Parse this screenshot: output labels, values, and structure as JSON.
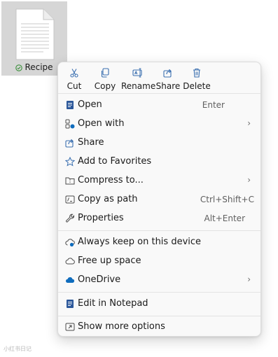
{
  "file": {
    "name": "Recipe",
    "icon": "text-document-icon",
    "status_icon": "sync-check-icon",
    "status_color": "#3a8f3a"
  },
  "quick_actions": [
    {
      "label": "Cut",
      "icon": "scissors-icon"
    },
    {
      "label": "Copy",
      "icon": "copy-icon"
    },
    {
      "label": "Rename",
      "icon": "rename-icon"
    },
    {
      "label": "Share",
      "icon": "share-icon"
    },
    {
      "label": "Delete",
      "icon": "trash-icon"
    }
  ],
  "menu": {
    "items": [
      {
        "label": "Open",
        "shortcut": "Enter",
        "icon": "notepad-icon"
      },
      {
        "label": "Open with",
        "shortcut": "",
        "icon": "open-with-icon",
        "submenu": "›"
      },
      {
        "label": "Share",
        "shortcut": "",
        "icon": "share-icon"
      },
      {
        "label": "Add to Favorites",
        "shortcut": "",
        "icon": "star-icon"
      },
      {
        "label": "Compress to...",
        "shortcut": "",
        "icon": "zip-folder-icon",
        "submenu": "›"
      },
      {
        "label": "Copy as path",
        "shortcut": "Ctrl+Shift+C",
        "icon": "path-icon"
      },
      {
        "label": "Properties",
        "shortcut": "Alt+Enter",
        "icon": "wrench-icon"
      },
      {
        "label": "Always keep on this device",
        "shortcut": "",
        "icon": "cloud-pin-icon"
      },
      {
        "label": "Free up space",
        "shortcut": "",
        "icon": "cloud-outline-icon"
      },
      {
        "label": "OneDrive",
        "shortcut": "",
        "icon": "onedrive-icon",
        "submenu": "›"
      },
      {
        "label": "Edit in Notepad",
        "shortcut": "",
        "icon": "notepad-icon"
      },
      {
        "label": "Show more options",
        "shortcut": "",
        "icon": "more-options-icon"
      }
    ]
  },
  "colors": {
    "accent": "#0f6cbd",
    "menu_bg": "#f9f9f9",
    "selection_bg": "#d6d6d6"
  },
  "watermark": "小红书日记"
}
